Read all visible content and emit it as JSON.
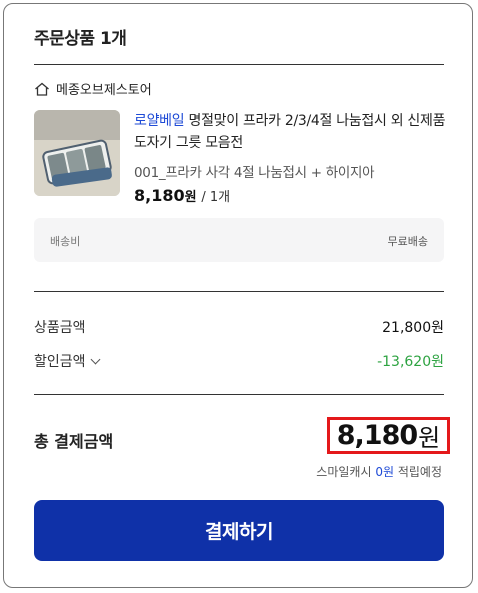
{
  "section_title": "주문상품 1개",
  "seller": {
    "name": "메종오브제스토어",
    "icon": "home-icon"
  },
  "product": {
    "brand": "로얄베일",
    "name": "명절맞이 프라카 2/3/4절 나눔접시 외 신제품 도자기 그릇 모음전",
    "option": "001_프라카 사각 4절 나눔접시 + 하이지아",
    "price": "8,180",
    "price_unit": "원",
    "qty": "/ 1개"
  },
  "shipping": {
    "label": "배송비",
    "value": "무료배송"
  },
  "summary": {
    "product_amount_label": "상품금액",
    "product_amount": "21,800원",
    "discount_label": "할인금액",
    "discount_amount": "-13,620원"
  },
  "total": {
    "label": "총 결제금액",
    "amount": "8,180",
    "unit": "원",
    "points_prefix": "스마일캐시",
    "points_value": "0원",
    "points_suffix": "적립예정"
  },
  "pay_button": "결제하기",
  "colors": {
    "accent": "#0f31a8",
    "brand_link": "#1e4ad6",
    "discount": "#2da341",
    "highlight_border": "#e4181b"
  }
}
